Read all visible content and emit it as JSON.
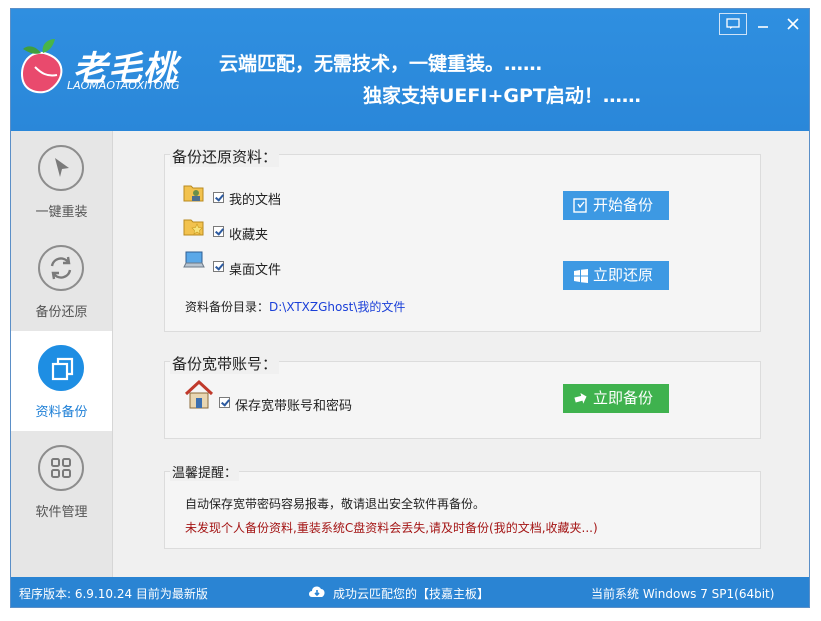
{
  "header": {
    "title": "老毛桃",
    "subtitle": "LAOMAOTAOXITONG",
    "slogan_line1": "云端匹配，无需技术，一键重装。……",
    "slogan_line2": "独家支持UEFI+GPT启动！……"
  },
  "sidebar": {
    "items": [
      {
        "label": "一键重装",
        "icon": "cursor-icon"
      },
      {
        "label": "备份还原",
        "icon": "refresh-icon"
      },
      {
        "label": "资料备份",
        "icon": "copy-icon",
        "active": true
      },
      {
        "label": "软件管理",
        "icon": "grid-icon"
      }
    ]
  },
  "backup": {
    "title": "备份还原资料：",
    "items": [
      "我的文档",
      "收藏夹",
      "桌面文件"
    ],
    "start_button": "开始备份",
    "restore_button": "立即还原",
    "dir_label": "资料备份目录：",
    "dir_value": "D:\\XTXZGhost\\我的文件"
  },
  "broadband": {
    "title": "备份宽带账号：",
    "item": "保存宽带账号和密码",
    "button": "立即备份"
  },
  "tips": {
    "title": "温馨提醒：",
    "line1": "自动保存宽带密码容易报毒，敬请退出安全软件再备份。",
    "line2": "未发现个人备份资料,重装系统C盘资料会丢失,请及时备份(我的文档,收藏夹...)"
  },
  "status": {
    "version": "程序版本: 6.9.10.24 目前为最新版",
    "cloud": "成功云匹配您的【技嘉主板】",
    "system": "当前系统 Windows 7 SP1(64bit)"
  },
  "colors": {
    "header": "#2f8fe0",
    "accent_blue": "#3d99e3",
    "accent_green": "#3fb24e",
    "warning": "#a41515"
  }
}
